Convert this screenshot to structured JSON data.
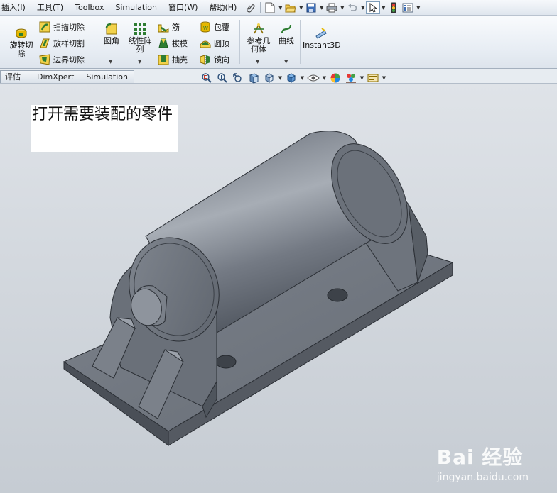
{
  "menubar": {
    "items": [
      "插入(I)",
      "工具(T)",
      "Toolbox",
      "Simulation",
      "窗口(W)",
      "帮助(H)"
    ]
  },
  "ribbon": {
    "revolve_cut": "旋转切除",
    "sweep_cut": "扫描切除",
    "loft_cut": "放样切割",
    "boundary_cut": "边界切除",
    "fillet": "圆角",
    "linear_pattern": "线性阵列",
    "rib": "筋",
    "draft": "拔模",
    "shell": "抽壳",
    "wrap": "包覆",
    "dome": "圆顶",
    "mirror": "镜向",
    "reference_geometry": "参考几何体",
    "curves": "曲线",
    "instant3d": "Instant3D"
  },
  "tabs": [
    "评估",
    "DimXpert",
    "Simulation"
  ],
  "icons": {
    "quick_access": [
      "paperclip-icon",
      "new-document-icon",
      "open-folder-icon",
      "save-icon",
      "print-icon",
      "undo-icon",
      "select-arrow-icon",
      "rebuild-traffic-light-icon",
      "options-icon"
    ],
    "heads_up": [
      "zoom-to-fit-icon",
      "zoom-area-icon",
      "previous-view-icon",
      "section-view-icon",
      "view-orientation-icon",
      "display-style-icon",
      "hide-show-items-icon",
      "edit-appearance-icon",
      "apply-scene-icon",
      "view-settings-icon"
    ]
  },
  "viewport": {
    "annotation": "打开需要装配的零件"
  },
  "watermark": {
    "logo": "Bai 经验",
    "url": "jingyan.baidu.com"
  },
  "colors": {
    "part_face": "#6d7480",
    "part_dark": "#3f444c",
    "part_light": "#9aa1ab",
    "background_top": "#dfe3e8",
    "background_bottom": "#c6ccd3"
  }
}
